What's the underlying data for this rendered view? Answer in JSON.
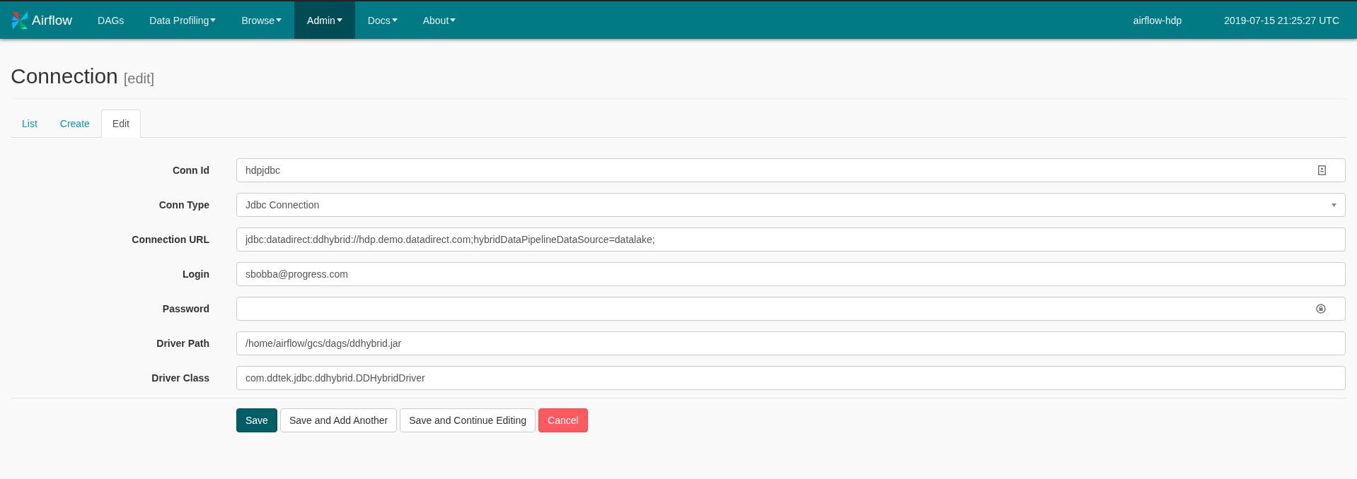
{
  "navbar": {
    "brand": "Airflow",
    "items": [
      {
        "label": "DAGs",
        "dropdown": false,
        "selected": false
      },
      {
        "label": "Data Profiling",
        "dropdown": true,
        "selected": false
      },
      {
        "label": "Browse",
        "dropdown": true,
        "selected": false
      },
      {
        "label": "Admin",
        "dropdown": true,
        "selected": true
      },
      {
        "label": "Docs",
        "dropdown": true,
        "selected": false
      },
      {
        "label": "About",
        "dropdown": true,
        "selected": false
      }
    ],
    "hostname": "airflow-hdp",
    "clock": "2019-07-15 21:25:27 UTC"
  },
  "page": {
    "title": "Connection",
    "subtitle": "[edit]"
  },
  "tabs": [
    {
      "label": "List",
      "selected": false
    },
    {
      "label": "Create",
      "selected": false
    },
    {
      "label": "Edit",
      "selected": true
    }
  ],
  "fields": [
    {
      "label": "Conn Id",
      "kind": "text",
      "value": "hdpjdbc",
      "autofill": true
    },
    {
      "label": "Conn Type",
      "kind": "select",
      "value": "Jdbc Connection",
      "autofill": false
    },
    {
      "label": "Connection URL",
      "kind": "text",
      "value": "jdbc:datadirect:ddhybrid://hdp.demo.datadirect.com;hybridDataPipelineDataSource=datalake;",
      "autofill": false
    },
    {
      "label": "Login",
      "kind": "text",
      "value": "sbobba@progress.com",
      "autofill": false
    },
    {
      "label": "Password",
      "kind": "password",
      "autofill": true
    },
    {
      "label": "Driver Path",
      "kind": "text",
      "value": "/home/airflow/gcs/dags/ddhybrid.jar",
      "autofill": false
    },
    {
      "label": "Driver Class",
      "kind": "text",
      "value": "com.ddtek.jdbc.ddhybrid.DDHybridDriver",
      "autofill": false
    }
  ],
  "buttons": [
    {
      "label": "Save",
      "kind": "primary"
    },
    {
      "label": "Save and Add Another",
      "kind": "default"
    },
    {
      "label": "Save and Continue Editing",
      "kind": "default"
    },
    {
      "label": "Cancel",
      "kind": "danger"
    }
  ]
}
